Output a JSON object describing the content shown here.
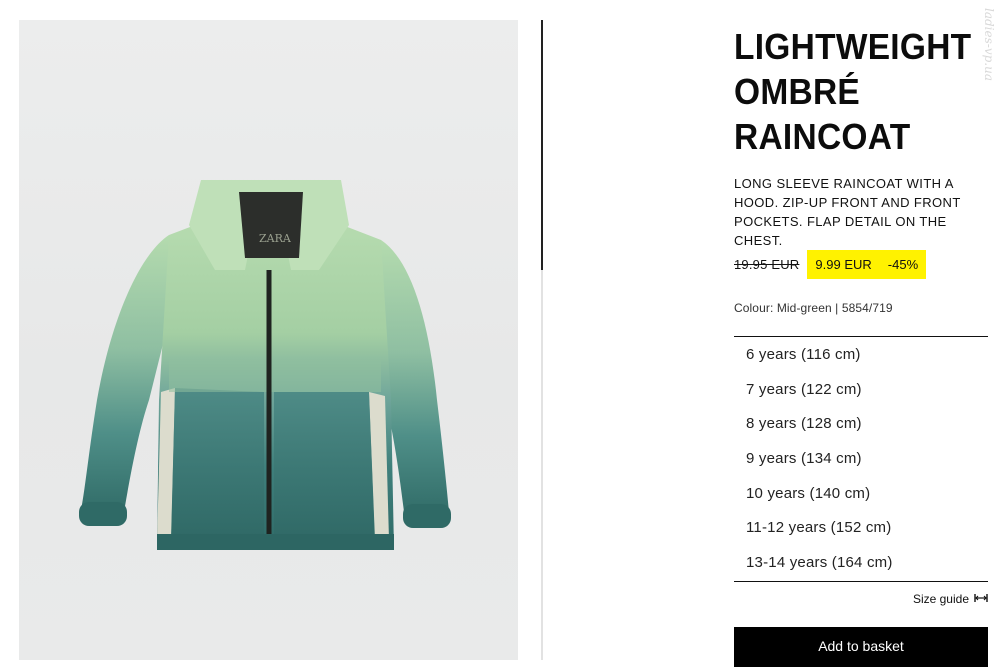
{
  "product": {
    "title": "LIGHTWEIGHT OMBRÉ RAINCOAT",
    "description": "LONG SLEEVE RAINCOAT WITH A HOOD. ZIP-UP FRONT AND FRONT POCKETS. FLAP DETAIL ON THE CHEST.",
    "image_alt": "Green to teal ombré hooded raincoat",
    "logo_text": "ZARA"
  },
  "price": {
    "original": "19.95 EUR",
    "sale": "9.99 EUR",
    "discount": "-45%"
  },
  "colour_info": "Colour: Mid-green | 5854/719",
  "sizes": [
    "6 years (116 cm)",
    "7 years (122 cm)",
    "8 years (128 cm)",
    "9 years (134 cm)",
    "10 years (140 cm)",
    "11-12 years (152 cm)",
    "13-14 years (164 cm)"
  ],
  "size_guide": {
    "label": "Size guide",
    "icon": "ruler-icon"
  },
  "add_to_basket_label": "Add to basket",
  "watermark": "ladies-vp.ua",
  "colors": {
    "sale_highlight": "#fff200",
    "button_bg": "#000000",
    "coat_top": "#a9d2a4",
    "coat_bottom": "#3e7a78"
  }
}
